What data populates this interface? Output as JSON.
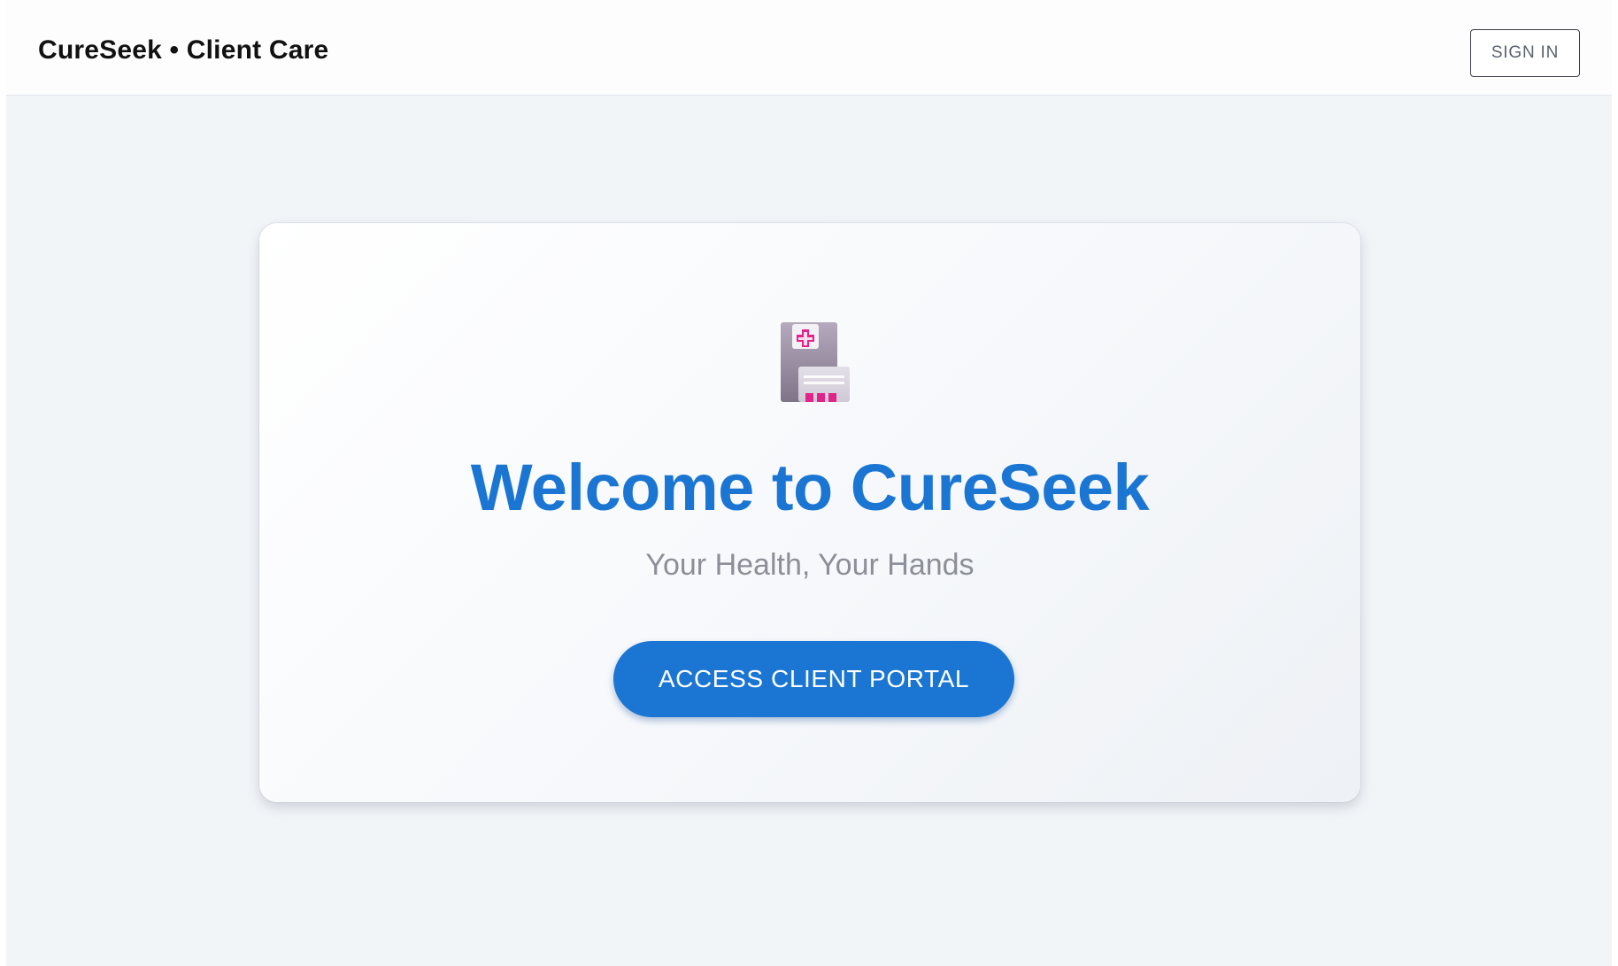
{
  "header": {
    "brand": "CureSeek • Client Care",
    "signin_label": "SIGN IN"
  },
  "hero": {
    "icon": "hospital-icon",
    "title": "Welcome to CureSeek",
    "subtitle": "Your Health, Your Hands",
    "cta_label": "ACCESS CLIENT PORTAL"
  },
  "colors": {
    "accent": "#1b76d3",
    "background": "#f2f5f8",
    "icon_magenta": "#e0248a",
    "icon_grey": "#9a8fa0"
  }
}
